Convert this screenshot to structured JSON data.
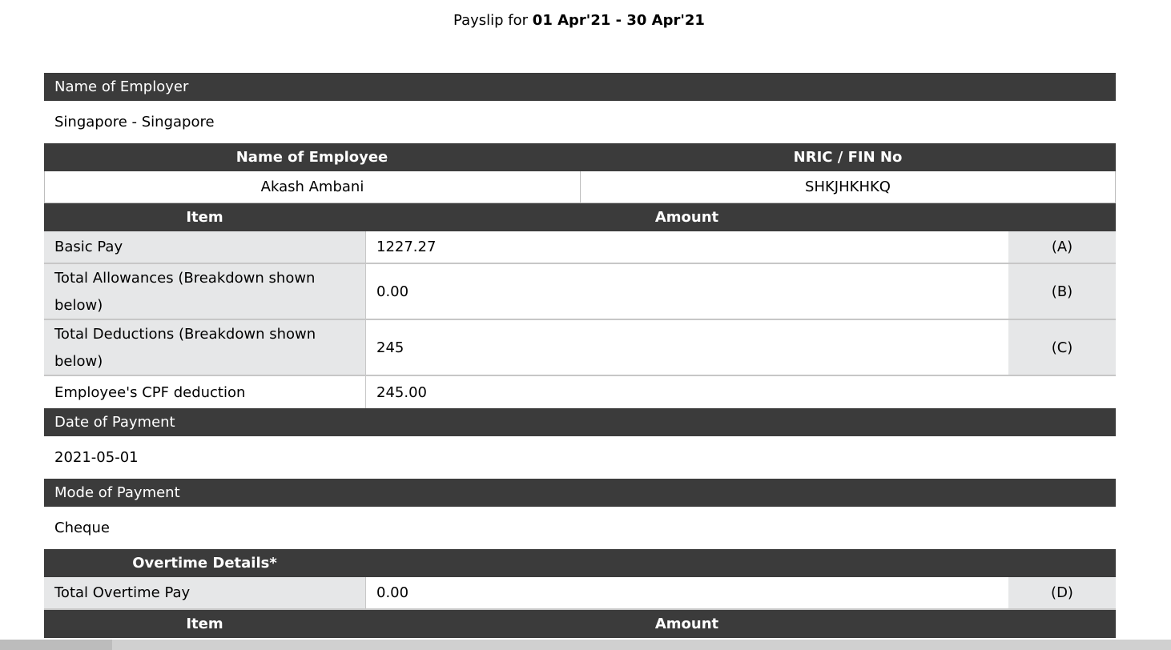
{
  "title": {
    "prefix": "Payslip for",
    "period": "01 Apr'21 - 30 Apr'21"
  },
  "employer": {
    "label": "Name of Employer",
    "value": "Singapore - Singapore"
  },
  "employee": {
    "name_label": "Name of Employee",
    "nric_label": "NRIC / FIN No",
    "name": "Akash Ambani",
    "nric": "SHKJHKHKQ"
  },
  "items_table": {
    "col_item": "Item",
    "col_amount": "Amount",
    "rows": [
      {
        "label": "Basic Pay",
        "amount": "1227.27",
        "code": "(A)"
      },
      {
        "label": "Total Allowances",
        "note": "(Breakdown shown below)",
        "amount": "0.00",
        "code": "(B)"
      },
      {
        "label": "Total Deductions",
        "note": "(Breakdown shown below)",
        "amount": "245",
        "code": "(C)"
      },
      {
        "label": "Employee's CPF deduction",
        "amount": "245.00",
        "code": ""
      }
    ]
  },
  "payment_date": {
    "label": "Date of Payment",
    "value": "2021-05-01"
  },
  "payment_mode": {
    "label": "Mode of Payment",
    "value": "Cheque"
  },
  "overtime": {
    "label": "Overtime Details*",
    "row_label": "Total Overtime Pay",
    "row_amount": "0.00",
    "row_code": "(D)"
  },
  "items_table_2": {
    "col_item": "Item",
    "col_amount": "Amount"
  }
}
